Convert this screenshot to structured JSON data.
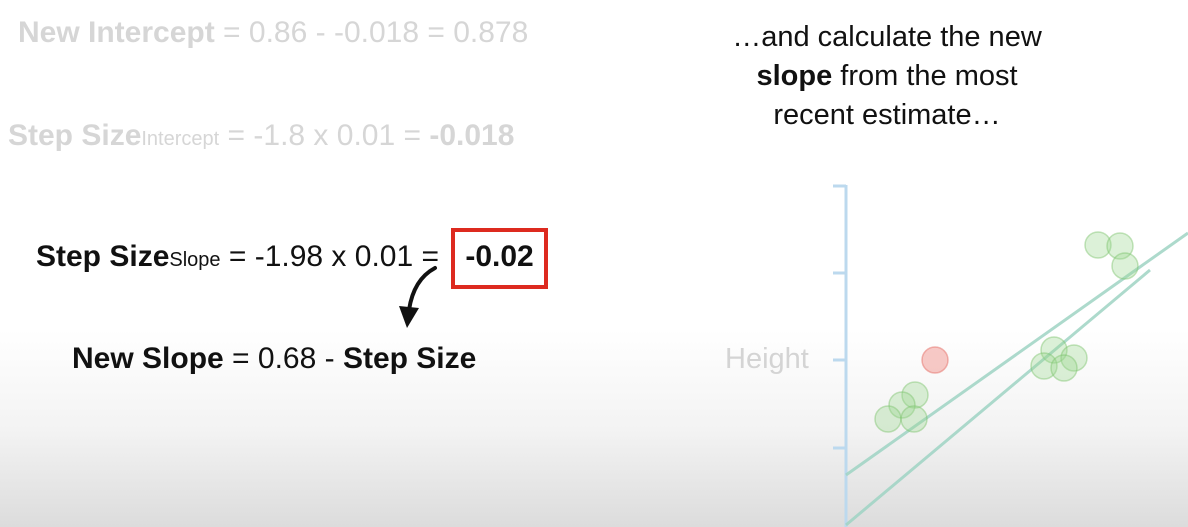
{
  "equations": {
    "new_intercept": {
      "label": "New Intercept",
      "rhs": " = 0.86 - -0.018 = 0.878"
    },
    "step_size_intercept": {
      "label": "Step Size",
      "subscript": "Intercept",
      "rhs": " = -1.8 x 0.01 = ",
      "result": "-0.018"
    },
    "step_size_slope": {
      "label": "Step Size",
      "subscript": "Slope",
      "rhs": " = -1.98 x 0.01 = ",
      "result": "-0.02"
    },
    "new_slope": {
      "label": "New Slope",
      "rhs": " = 0.68 - ",
      "step_label": "Step Size"
    }
  },
  "caption": {
    "line1": "…and calculate the new",
    "line2_bold": "slope",
    "line2_rest": " from the most",
    "line3": "recent estimate…"
  },
  "plot": {
    "y_axis_label": "Height"
  },
  "colors": {
    "highlight_box": "#dd2a1f",
    "faded_text": "#d6d6d6",
    "axis": "#bcd9ee",
    "points": "#9bd88e",
    "highlight_point": "#f08a82",
    "fit_lines": "#9fd4c4"
  }
}
